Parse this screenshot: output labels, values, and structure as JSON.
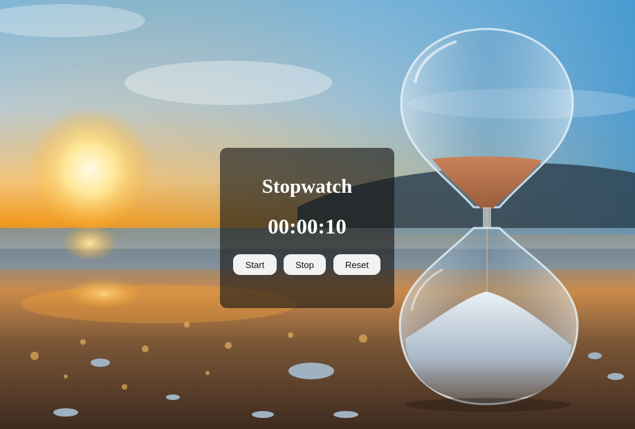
{
  "stopwatch": {
    "title": "Stopwatch",
    "time": "00:00:10",
    "buttons": {
      "start": "Start",
      "stop": "Stop",
      "reset": "Reset"
    }
  },
  "colors": {
    "card_background": "#141414",
    "button_background": "#f2f2f2",
    "text": "#ffffff",
    "sky_top": "#5aa7d6",
    "sunset_orange": "#f29a1e",
    "sand": "#6b4a33"
  },
  "background": {
    "scene": "hourglass-on-beach-at-sunset"
  }
}
